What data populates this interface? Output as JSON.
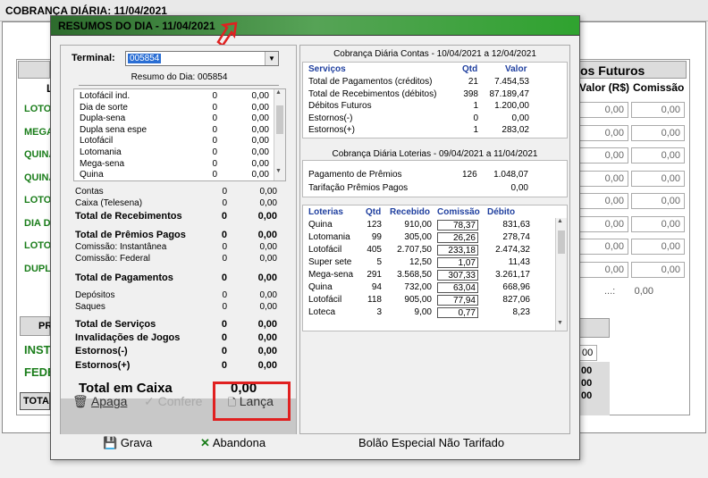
{
  "app": {
    "title": "COBRANÇA DIÁRIA: 11/04/2021",
    "bg_header_right": "os Futuros",
    "bg_col_valor": "Valor (R$)",
    "bg_col_comissao": "Comissão",
    "bg_col_l": "L",
    "bg_games": [
      "LOTO",
      "MEGA",
      "QUINA",
      "QUINA",
      "LOTO",
      "DIA DE",
      "LOTO",
      "DUPLA"
    ],
    "bg_values": [
      "0,00",
      "0,00",
      "0,00",
      "0,00",
      "0,00",
      "0,00",
      "0,00",
      "0,00"
    ],
    "bg_total_label": "0,00",
    "bg_bottom": {
      "pr": "PR",
      "inst": "INST",
      "fed": "FEDE",
      "tota": "TOTA"
    },
    "bg_right_small": [
      "00",
      "00",
      "00",
      "00"
    ]
  },
  "modal": {
    "title": "RESUMOS DO DIA - 11/04/2021",
    "terminal_label": "Terminal:",
    "terminal_value": "005854",
    "resumo_label": "Resumo do Dia: 005854",
    "games": [
      {
        "name": "Lotofácil ind.",
        "q": "0",
        "v": "0,00"
      },
      {
        "name": "Dia de sorte",
        "q": "0",
        "v": "0,00"
      },
      {
        "name": "Dupla-sena",
        "q": "0",
        "v": "0,00"
      },
      {
        "name": "Dupla sena espe",
        "q": "0",
        "v": "0,00"
      },
      {
        "name": "Lotofácil",
        "q": "0",
        "v": "0,00"
      },
      {
        "name": "Lotomania",
        "q": "0",
        "v": "0,00"
      },
      {
        "name": "Mega-sena",
        "q": "0",
        "v": "0,00"
      },
      {
        "name": "Quina",
        "q": "0",
        "v": "0,00"
      }
    ],
    "summary": [
      {
        "name": "Contas",
        "q": "0",
        "v": "0,00",
        "bold": false
      },
      {
        "name": "Caixa (Telesena)",
        "q": "0",
        "v": "0,00",
        "bold": false
      },
      {
        "name": "Total de Recebimentos",
        "q": "0",
        "v": "0,00",
        "bold": true
      },
      {
        "name": "Total de Prêmios Pagos",
        "q": "0",
        "v": "0,00",
        "bold": true
      },
      {
        "name": "Comissão: Instantânea",
        "q": "0",
        "v": "0,00",
        "bold": false
      },
      {
        "name": "Comissão: Federal",
        "q": "0",
        "v": "0,00",
        "bold": false
      },
      {
        "name": "Total de Pagamentos",
        "q": "0",
        "v": "0,00",
        "bold": true
      },
      {
        "name": "Depósitos",
        "q": "0",
        "v": "0,00",
        "bold": false
      },
      {
        "name": "Saques",
        "q": "0",
        "v": "0,00",
        "bold": false
      },
      {
        "name": "Total de Serviços",
        "q": "0",
        "v": "0,00",
        "bold": true
      },
      {
        "name": "Invalidações de Jogos",
        "q": "0",
        "v": "0,00",
        "bold": true
      },
      {
        "name": "Estornos(-)",
        "q": "0",
        "v": "0,00",
        "bold": true
      },
      {
        "name": "Estornos(+)",
        "q": "0",
        "v": "0,00",
        "bold": true
      }
    ],
    "total_caixa_label": "Total em Caixa",
    "total_caixa_value": "0,00",
    "buttons": {
      "apaga": "Apaga",
      "confere": "Confere",
      "lanca": "Lança",
      "grava": "Grava",
      "abandona": "Abandona"
    },
    "bolao_text": "Bolão Especial Não Tarifado",
    "contas": {
      "title": "Cobrança Diária Contas - 10/04/2021 a 12/04/2021",
      "col_servicos": "Serviços",
      "col_qtd": "Qtd",
      "col_valor": "Valor",
      "rows": [
        {
          "name": "Total de Pagamentos (créditos)",
          "q": "21",
          "v": "7.454,53"
        },
        {
          "name": "Total de Recebimentos (débitos)",
          "q": "398",
          "v": "87.189,47"
        },
        {
          "name": "Débitos Futuros",
          "q": "1",
          "v": "1.200,00"
        },
        {
          "name": "Estornos(-)",
          "q": "0",
          "v": "0,00"
        },
        {
          "name": "Estornos(+)",
          "q": "1",
          "v": "283,02"
        }
      ]
    },
    "loterias": {
      "title": "Cobrança Diária Loterias - 09/04/2021 a 11/04/2021",
      "pagamento_label": "Pagamento de Prêmios",
      "pagamento_q": "126",
      "pagamento_v": "1.048,07",
      "tarifacao_label": "Tarifação Prêmios Pagos",
      "tarifacao_v": "0,00",
      "col_loterias": "Loterias",
      "col_qtd": "Qtd",
      "col_recebido": "Recebido",
      "col_comissao": "Comissão",
      "col_debito": "Débito",
      "rows": [
        {
          "name": "Quina",
          "q": "123",
          "r": "910,00",
          "c": "78,37",
          "d": "831,63"
        },
        {
          "name": "Lotomania",
          "q": "99",
          "r": "305,00",
          "c": "26,26",
          "d": "278,74"
        },
        {
          "name": "Lotofácil",
          "q": "405",
          "r": "2.707,50",
          "c": "233,18",
          "d": "2.474,32"
        },
        {
          "name": "Super sete",
          "q": "5",
          "r": "12,50",
          "c": "1,07",
          "d": "11,43"
        },
        {
          "name": "Mega-sena",
          "q": "291",
          "r": "3.568,50",
          "c": "307,33",
          "d": "3.261,17"
        },
        {
          "name": "Quina",
          "q": "94",
          "r": "732,00",
          "c": "63,04",
          "d": "668,96"
        },
        {
          "name": "Lotofácil",
          "q": "118",
          "r": "905,00",
          "c": "77,94",
          "d": "827,06"
        },
        {
          "name": "Loteca",
          "q": "3",
          "r": "9,00",
          "c": "0,77",
          "d": "8,23"
        }
      ]
    }
  }
}
